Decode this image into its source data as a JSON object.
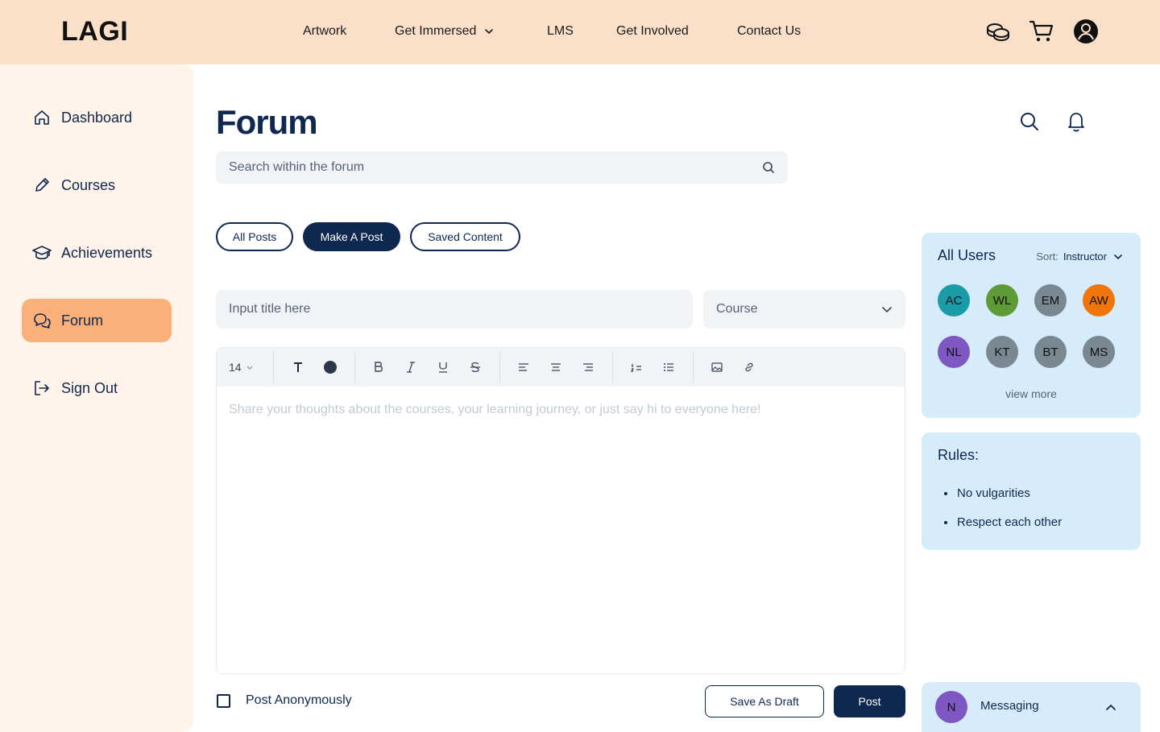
{
  "header": {
    "logo": "LAGI",
    "nav": [
      {
        "label": "Artwork"
      },
      {
        "label": "Get Immersed"
      },
      {
        "label": "LMS"
      },
      {
        "label": "Get Involved"
      },
      {
        "label": "Contact Us"
      }
    ],
    "icons": [
      "coins-icon",
      "cart-icon",
      "account-icon"
    ]
  },
  "sidebar": {
    "items": [
      {
        "label": "Dashboard",
        "icon": "home-icon",
        "active": false
      },
      {
        "label": "Courses",
        "icon": "pencil-icon",
        "active": false
      },
      {
        "label": "Achievements",
        "icon": "graduation-cap-icon",
        "active": false
      },
      {
        "label": "Forum",
        "icon": "chat-icon",
        "active": true
      },
      {
        "label": "Sign Out",
        "icon": "sign-out-icon",
        "active": false
      }
    ]
  },
  "main": {
    "title": "Forum",
    "search_placeholder": "Search within the forum",
    "tabs": [
      {
        "label": "All Posts",
        "active": false
      },
      {
        "label": "Make A Post",
        "active": true
      },
      {
        "label": "Saved Content",
        "active": false
      }
    ],
    "title_placeholder": "Input title here",
    "course_select": "Course",
    "toolbar": {
      "font_size": "14",
      "tools": [
        "text-icon",
        "color-dot-icon",
        "bold-icon",
        "italic-icon",
        "underline-icon",
        "strikethrough-icon",
        "align-left-icon",
        "align-center-icon",
        "align-right-icon",
        "ordered-list-icon",
        "bullet-list-icon",
        "image-icon",
        "link-icon"
      ]
    },
    "editor_placeholder": "Share your thoughts about the courses, your learning journey, or just say hi to everyone here!",
    "anonymous_label": "Post Anonymously",
    "save_draft_label": "Save As Draft",
    "post_label": "Post"
  },
  "users_panel": {
    "title": "All Users",
    "sort_label": "Sort:",
    "sort_value": "Instructor",
    "users": [
      {
        "initials": "AC",
        "color": "#1a9ba8"
      },
      {
        "initials": "WL",
        "color": "#5e9a35"
      },
      {
        "initials": "EM",
        "color": "#7a8892"
      },
      {
        "initials": "AW",
        "color": "#f0750a"
      },
      {
        "initials": "NL",
        "color": "#7e57c2"
      },
      {
        "initials": "KT",
        "color": "#7a8892"
      },
      {
        "initials": "BT",
        "color": "#7a8892"
      },
      {
        "initials": "MS",
        "color": "#7a8892"
      }
    ],
    "view_more": "view more"
  },
  "rules_panel": {
    "title": "Rules:",
    "rules": [
      "No vulgarities",
      "Respect each other"
    ]
  },
  "messaging": {
    "avatar": "N",
    "label": "Messaging"
  },
  "colors": {
    "navy": "#0f2850",
    "topbar": "#fae0c8",
    "sidebar": "#fff3ea",
    "active_item": "#fbb079",
    "panel": "#d7ecfb"
  }
}
